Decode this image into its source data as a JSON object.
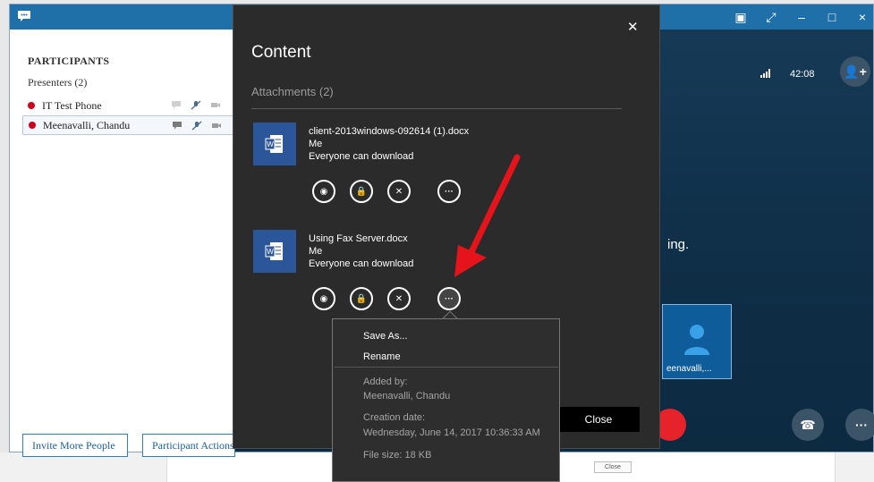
{
  "participants": {
    "header": "PARTICIPANTS",
    "group_label": "Presenters (2)",
    "rows": [
      {
        "name": "IT Test Phone"
      },
      {
        "name": "Meenavalli, Chandu"
      }
    ],
    "invite_button": "Invite More People",
    "actions_button": "Participant Actions"
  },
  "conversation": {
    "timer": "42:08",
    "partial_text": "ing.",
    "tile_name": "eenavalli,..."
  },
  "modal": {
    "title": "Content",
    "attachments_header": "Attachments (2)",
    "close_label": "Close",
    "files": [
      {
        "name": "client-2013windows-092614 (1).docx",
        "owner": "Me",
        "permission": "Everyone can download"
      },
      {
        "name": "Using Fax Server.docx",
        "owner": "Me",
        "permission": "Everyone can download"
      }
    ]
  },
  "menu": {
    "save_as": "Save As...",
    "rename": "Rename",
    "added_by_label": "Added by:",
    "added_by_value": "Meenavalli, Chandu",
    "creation_label": "Creation date:",
    "creation_value": "Wednesday, June 14, 2017 10:36:33 AM",
    "file_size": "File size: 18 KB"
  },
  "background": {
    "close_label": "Close"
  },
  "colors": {
    "titlebar": "#1f6fa8",
    "presence_busy": "#d0021b",
    "word_blue": "#2b579a",
    "modal_bg": "#2b2b2b",
    "annotation_arrow": "#e5141b",
    "hangup_red": "#e6232b"
  },
  "icons": [
    "chat-icon",
    "eye-icon",
    "lock-icon",
    "remove-icon",
    "more-icon",
    "word-doc-icon",
    "signal-icon",
    "add-person-icon",
    "call-settings-icon"
  ]
}
